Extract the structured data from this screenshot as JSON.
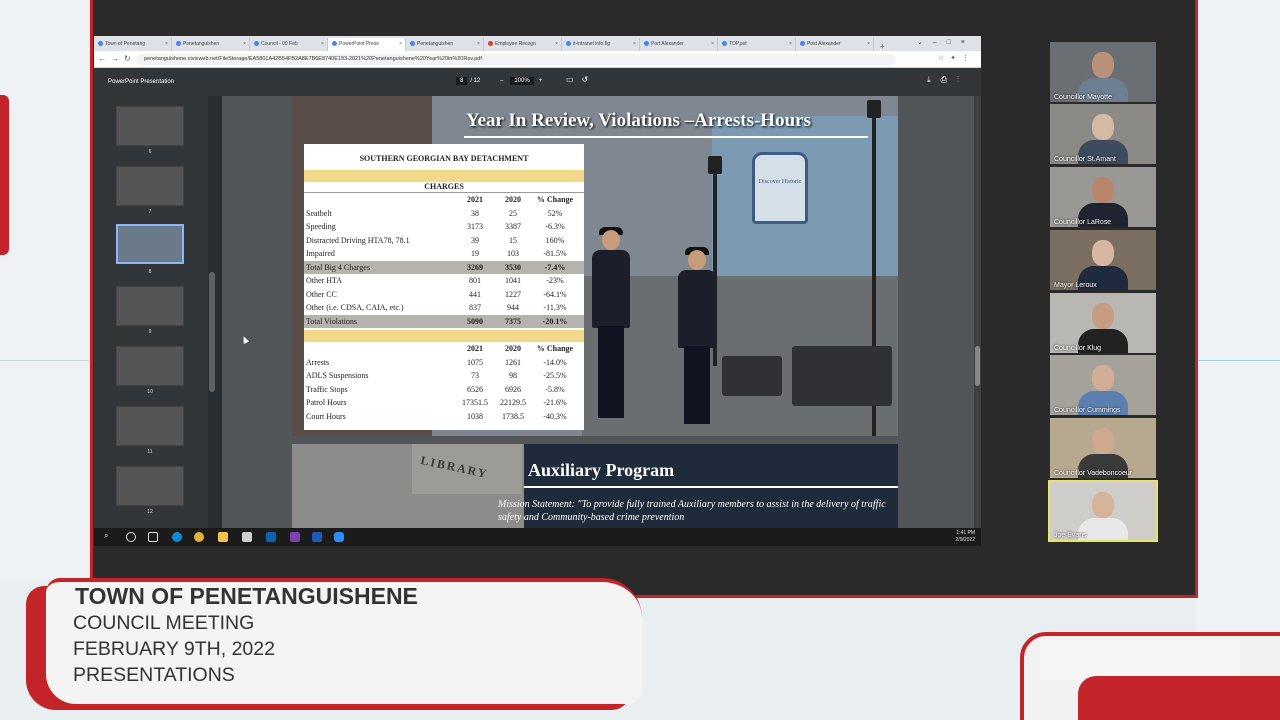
{
  "browser": {
    "tabs": [
      {
        "label": "Town of Penetang"
      },
      {
        "label": "Penetanguishen"
      },
      {
        "label": "Council - 09 Feb"
      },
      {
        "label": "PowerPoint Prese",
        "active": true
      },
      {
        "label": "Penetanguishen"
      },
      {
        "label": "Employee Recogn"
      },
      {
        "label": "it-intranet info.fig"
      },
      {
        "label": "Port Alexander"
      },
      {
        "label": "TOP.pst"
      },
      {
        "label": "Post Alexander"
      }
    ],
    "url": "penetanguishene.civicweb.net/FileStorage/EA5801A42B54FB2A8E7B6E8740E193-2021%20Penetanguishene%20Year%20in%20Rev.pdf"
  },
  "pdf": {
    "title": "PowerPoint Presentation",
    "page_current": "8",
    "page_total": "/ 12",
    "zoom": "100%",
    "thumb_numbers": [
      "6",
      "7",
      "8",
      "9",
      "10",
      "11",
      "12"
    ]
  },
  "slide": {
    "title": "Year In Review, Violations –Arrests-Hours",
    "sign_text": "Discover Historic",
    "table_heading": "SOUTHERN GEORGIAN BAY DETACHMENT",
    "charges_label": "CHARGES",
    "columns": [
      "2021",
      "2020",
      "% Change"
    ],
    "charges_rows": [
      {
        "label": "Seatbelt",
        "y2021": "38",
        "y2020": "25",
        "change": "52%"
      },
      {
        "label": "Speeding",
        "y2021": "3173",
        "y2020": "3387",
        "change": "-6.3%"
      },
      {
        "label": "Distracted Driving HTA78, 78.1",
        "y2021": "39",
        "y2020": "15",
        "change": "160%"
      },
      {
        "label": "Impaired",
        "y2021": "19",
        "y2020": "103",
        "change": "-81.5%"
      },
      {
        "label": "Total Big 4 Charges",
        "y2021": "3269",
        "y2020": "3530",
        "change": "-7.4%",
        "total": true
      },
      {
        "label": "Other HTA",
        "y2021": "801",
        "y2020": "1041",
        "change": "-23%"
      },
      {
        "label": "Other CC",
        "y2021": "441",
        "y2020": "1227",
        "change": "-64.1%"
      },
      {
        "label": "Other      (i.e. CDSA, CAIA, etc.)",
        "y2021": "837",
        "y2020": "944",
        "change": "-11.3%"
      },
      {
        "label": "Total Violations",
        "y2021": "5090",
        "y2020": "7375",
        "change": "-20.1%",
        "total": true
      }
    ],
    "other_rows": [
      {
        "label": "Arrests",
        "y2021": "1075",
        "y2020": "1261",
        "change": "-14.0%"
      },
      {
        "label": "ADLS Suspensions",
        "y2021": "73",
        "y2020": "98",
        "change": "-25.5%"
      },
      {
        "label": "Traffic Stops",
        "y2021": "6526",
        "y2020": "6926",
        "change": "-5.8%"
      },
      {
        "label": "Patrol Hours",
        "y2021": "17351.5",
        "y2020": "22129.5",
        "change": "-21.6%"
      },
      {
        "label": "Court Hours",
        "y2021": "1038",
        "y2020": "1738.5",
        "change": "-40.3%"
      }
    ]
  },
  "slide2": {
    "title": "Auxiliary Program",
    "image_text": "LIBRARY",
    "mission": "Mission Statement: \"To provide fully trained Auxiliary members to assist in the delivery of traffic safety and Community-based crime prevention"
  },
  "taskbar": {
    "time": "1:41 PM",
    "date": "2/9/2022"
  },
  "participants": [
    {
      "name": "Councillor Mayotte"
    },
    {
      "name": "Councillor St.Amant"
    },
    {
      "name": "Councillor LaRose"
    },
    {
      "name": "Mayor Leroux"
    },
    {
      "name": "Councillor Klug"
    },
    {
      "name": "Councillor Cummings"
    },
    {
      "name": "Councillor Vadeboncoeur"
    },
    {
      "name": "Joe Evans",
      "active": true
    }
  ],
  "lower_third": {
    "title": "TOWN OF PENETANGUISHENE",
    "line1": "COUNCIL MEETING",
    "line2": "FEBRUARY 9TH, 2022",
    "line3": "PRESENTATIONS"
  },
  "colors": {
    "brand_red": "#c3242a",
    "active_speaker": "#e4e36b",
    "pdf_toolbar": "#323639",
    "table_band": "#f4d98a"
  }
}
